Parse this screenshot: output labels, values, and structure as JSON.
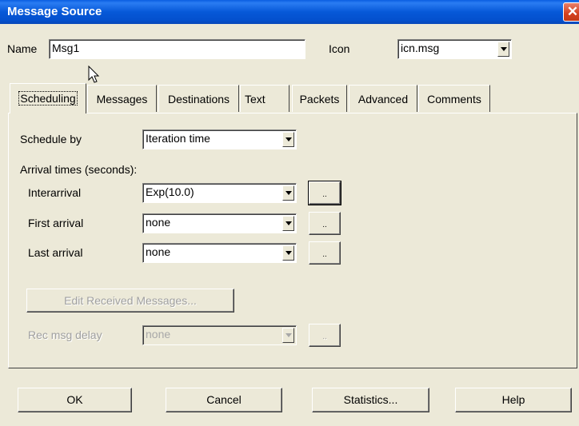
{
  "window": {
    "title": "Message Source",
    "close_glyph": "✕"
  },
  "header": {
    "name_label": "Name",
    "name_value": "Msg1",
    "icon_label": "Icon",
    "icon_value": "icn.msg"
  },
  "tabs": [
    {
      "label": "Scheduling",
      "active": true
    },
    {
      "label": "Messages"
    },
    {
      "label": "Destinations"
    },
    {
      "label": "Text"
    },
    {
      "label": "Packets"
    },
    {
      "label": "Advanced"
    },
    {
      "label": "Comments"
    }
  ],
  "scheduling": {
    "schedule_by_label": "Schedule by",
    "schedule_by_value": "Iteration time",
    "arrival_times_label": "Arrival times (seconds):",
    "interarrival_label": "Interarrival",
    "interarrival_value": "Exp(10.0)",
    "first_arrival_label": "First arrival",
    "first_arrival_value": "none",
    "last_arrival_label": "Last arrival",
    "last_arrival_value": "none",
    "ellipsis_button": "..",
    "edit_received_label": "Edit Received Messages...",
    "rec_msg_delay_label": "Rec msg delay",
    "rec_msg_delay_value": "none"
  },
  "footer": {
    "ok": "OK",
    "cancel": "Cancel",
    "statistics": "Statistics...",
    "help": "Help"
  }
}
